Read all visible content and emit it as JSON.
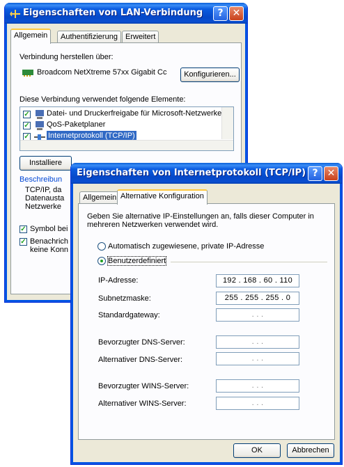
{
  "lan": {
    "title": "Eigenschaften von LAN-Verbindung",
    "tabs": [
      "Allgemein",
      "Authentifizierung",
      "Erweitert"
    ],
    "connect_via_label": "Verbindung herstellen über:",
    "adapter_name": "Broadcom NetXtreme 57xx Gigabit Cc",
    "configure_button": "Konfigurieren...",
    "elements_label": "Diese Verbindung verwendet folgende Elemente:",
    "elements": [
      {
        "label": "Datei- und Druckerfreigabe für Microsoft-Netzwerke",
        "checked": true,
        "icon": "network-share-icon"
      },
      {
        "label": "QoS-Paketplaner",
        "checked": true,
        "icon": "qos-icon"
      },
      {
        "label": "Internetprotokoll (TCP/IP)",
        "checked": true,
        "icon": "protocol-icon",
        "selected": true
      }
    ],
    "install_button": "Installiere",
    "description_title": "Beschreibun",
    "description_lines": [
      "TCP/IP, da",
      "Datenausta",
      "Netzwerke"
    ],
    "show_icon_label": "Symbol bei",
    "notify_label_1": "Benachrich",
    "notify_label_2": "keine Konn"
  },
  "tcpip": {
    "title": "Eigenschaften von Internetprotokoll (TCP/IP)",
    "tabs": [
      "Allgemein",
      "Alternative Konfiguration"
    ],
    "intro": "Geben Sie alternative IP-Einstellungen an, falls dieser Computer in mehreren Netzwerken verwendet wird.",
    "radio_auto": "Automatisch zugewiesene, private IP-Adresse",
    "radio_custom": "Benutzerdefiniert",
    "fields": [
      {
        "label": "IP-Adresse:",
        "value": "192 . 168 . 60 . 110"
      },
      {
        "label": "Subnetzmaske:",
        "value": "255 . 255 . 255 .  0"
      },
      {
        "label": "Standardgateway:",
        "value": ".      .      ."
      },
      {
        "label": "Bevorzugter DNS-Server:",
        "value": ".      .      ."
      },
      {
        "label": "Alternativer DNS-Server:",
        "value": ".      .      ."
      },
      {
        "label": "Bevorzugter WINS-Server:",
        "value": ".      .      ."
      },
      {
        "label": "Alternativer WINS-Server:",
        "value": ".      .      ."
      }
    ],
    "ok_button": "OK",
    "cancel_button": "Abbrechen"
  },
  "colors": {
    "title_blue": "#0548c8",
    "dialog_bg": "#ece9d8",
    "selection": "#316ac5",
    "close_red": "#c8401c"
  }
}
